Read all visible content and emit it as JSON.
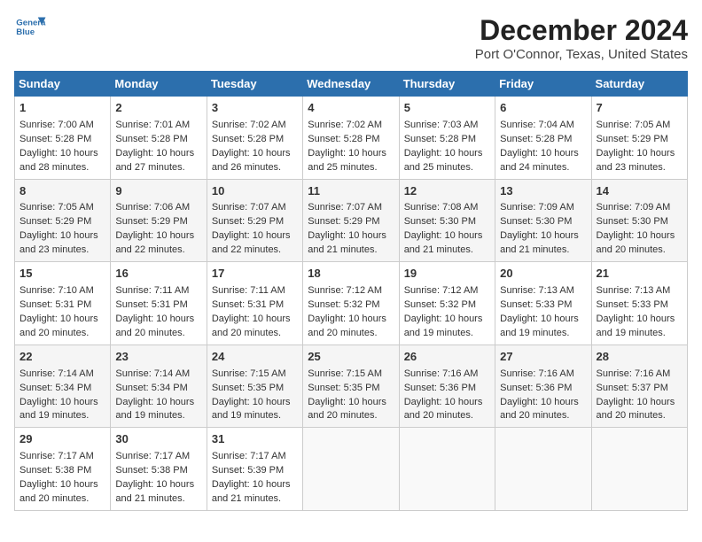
{
  "header": {
    "logo_line1": "General",
    "logo_line2": "Blue",
    "title": "December 2024",
    "subtitle": "Port O'Connor, Texas, United States"
  },
  "calendar": {
    "days_of_week": [
      "Sunday",
      "Monday",
      "Tuesday",
      "Wednesday",
      "Thursday",
      "Friday",
      "Saturday"
    ],
    "weeks": [
      [
        {
          "day": "",
          "data": ""
        },
        {
          "day": "",
          "data": ""
        },
        {
          "day": "",
          "data": ""
        },
        {
          "day": "",
          "data": ""
        },
        {
          "day": "",
          "data": ""
        },
        {
          "day": "",
          "data": ""
        },
        {
          "day": "",
          "data": ""
        }
      ],
      [
        {
          "day": "1",
          "data": "Sunrise: 7:00 AM\nSunset: 5:28 PM\nDaylight: 10 hours\nand 28 minutes."
        },
        {
          "day": "2",
          "data": "Sunrise: 7:01 AM\nSunset: 5:28 PM\nDaylight: 10 hours\nand 27 minutes."
        },
        {
          "day": "3",
          "data": "Sunrise: 7:02 AM\nSunset: 5:28 PM\nDaylight: 10 hours\nand 26 minutes."
        },
        {
          "day": "4",
          "data": "Sunrise: 7:02 AM\nSunset: 5:28 PM\nDaylight: 10 hours\nand 25 minutes."
        },
        {
          "day": "5",
          "data": "Sunrise: 7:03 AM\nSunset: 5:28 PM\nDaylight: 10 hours\nand 25 minutes."
        },
        {
          "day": "6",
          "data": "Sunrise: 7:04 AM\nSunset: 5:28 PM\nDaylight: 10 hours\nand 24 minutes."
        },
        {
          "day": "7",
          "data": "Sunrise: 7:05 AM\nSunset: 5:29 PM\nDaylight: 10 hours\nand 23 minutes."
        }
      ],
      [
        {
          "day": "8",
          "data": "Sunrise: 7:05 AM\nSunset: 5:29 PM\nDaylight: 10 hours\nand 23 minutes."
        },
        {
          "day": "9",
          "data": "Sunrise: 7:06 AM\nSunset: 5:29 PM\nDaylight: 10 hours\nand 22 minutes."
        },
        {
          "day": "10",
          "data": "Sunrise: 7:07 AM\nSunset: 5:29 PM\nDaylight: 10 hours\nand 22 minutes."
        },
        {
          "day": "11",
          "data": "Sunrise: 7:07 AM\nSunset: 5:29 PM\nDaylight: 10 hours\nand 21 minutes."
        },
        {
          "day": "12",
          "data": "Sunrise: 7:08 AM\nSunset: 5:30 PM\nDaylight: 10 hours\nand 21 minutes."
        },
        {
          "day": "13",
          "data": "Sunrise: 7:09 AM\nSunset: 5:30 PM\nDaylight: 10 hours\nand 21 minutes."
        },
        {
          "day": "14",
          "data": "Sunrise: 7:09 AM\nSunset: 5:30 PM\nDaylight: 10 hours\nand 20 minutes."
        }
      ],
      [
        {
          "day": "15",
          "data": "Sunrise: 7:10 AM\nSunset: 5:31 PM\nDaylight: 10 hours\nand 20 minutes."
        },
        {
          "day": "16",
          "data": "Sunrise: 7:11 AM\nSunset: 5:31 PM\nDaylight: 10 hours\nand 20 minutes."
        },
        {
          "day": "17",
          "data": "Sunrise: 7:11 AM\nSunset: 5:31 PM\nDaylight: 10 hours\nand 20 minutes."
        },
        {
          "day": "18",
          "data": "Sunrise: 7:12 AM\nSunset: 5:32 PM\nDaylight: 10 hours\nand 20 minutes."
        },
        {
          "day": "19",
          "data": "Sunrise: 7:12 AM\nSunset: 5:32 PM\nDaylight: 10 hours\nand 19 minutes."
        },
        {
          "day": "20",
          "data": "Sunrise: 7:13 AM\nSunset: 5:33 PM\nDaylight: 10 hours\nand 19 minutes."
        },
        {
          "day": "21",
          "data": "Sunrise: 7:13 AM\nSunset: 5:33 PM\nDaylight: 10 hours\nand 19 minutes."
        }
      ],
      [
        {
          "day": "22",
          "data": "Sunrise: 7:14 AM\nSunset: 5:34 PM\nDaylight: 10 hours\nand 19 minutes."
        },
        {
          "day": "23",
          "data": "Sunrise: 7:14 AM\nSunset: 5:34 PM\nDaylight: 10 hours\nand 19 minutes."
        },
        {
          "day": "24",
          "data": "Sunrise: 7:15 AM\nSunset: 5:35 PM\nDaylight: 10 hours\nand 19 minutes."
        },
        {
          "day": "25",
          "data": "Sunrise: 7:15 AM\nSunset: 5:35 PM\nDaylight: 10 hours\nand 20 minutes."
        },
        {
          "day": "26",
          "data": "Sunrise: 7:16 AM\nSunset: 5:36 PM\nDaylight: 10 hours\nand 20 minutes."
        },
        {
          "day": "27",
          "data": "Sunrise: 7:16 AM\nSunset: 5:36 PM\nDaylight: 10 hours\nand 20 minutes."
        },
        {
          "day": "28",
          "data": "Sunrise: 7:16 AM\nSunset: 5:37 PM\nDaylight: 10 hours\nand 20 minutes."
        }
      ],
      [
        {
          "day": "29",
          "data": "Sunrise: 7:17 AM\nSunset: 5:38 PM\nDaylight: 10 hours\nand 20 minutes."
        },
        {
          "day": "30",
          "data": "Sunrise: 7:17 AM\nSunset: 5:38 PM\nDaylight: 10 hours\nand 21 minutes."
        },
        {
          "day": "31",
          "data": "Sunrise: 7:17 AM\nSunset: 5:39 PM\nDaylight: 10 hours\nand 21 minutes."
        },
        {
          "day": "",
          "data": ""
        },
        {
          "day": "",
          "data": ""
        },
        {
          "day": "",
          "data": ""
        },
        {
          "day": "",
          "data": ""
        }
      ]
    ]
  }
}
